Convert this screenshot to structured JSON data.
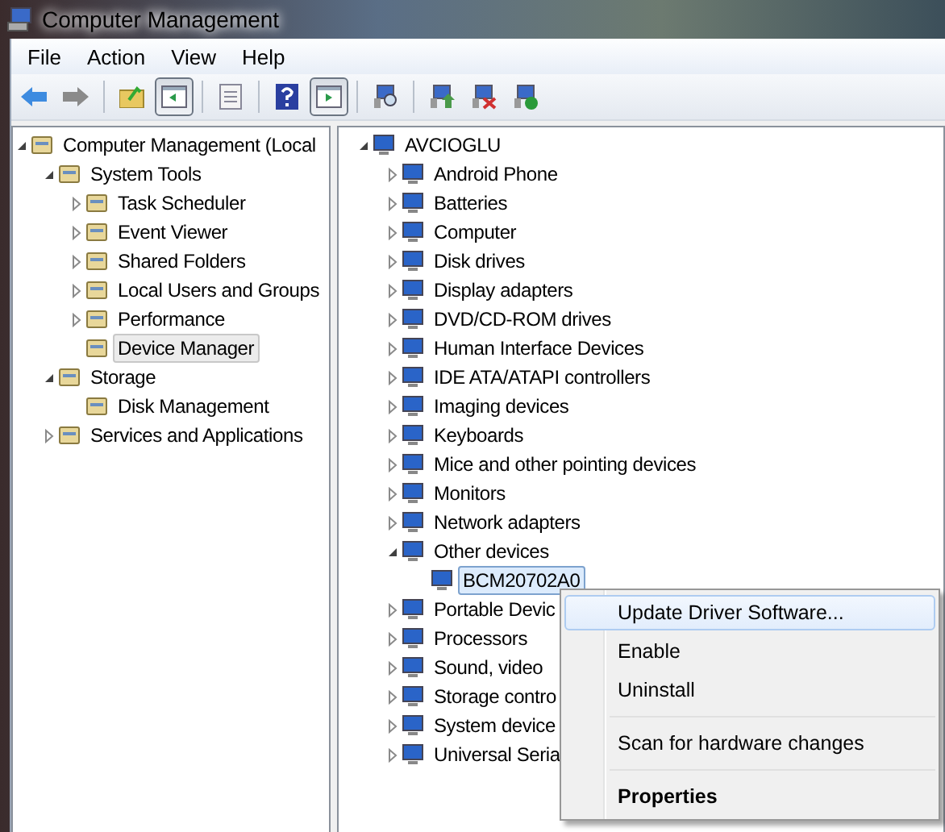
{
  "window": {
    "title": "Computer Management"
  },
  "menu": [
    "File",
    "Action",
    "View",
    "Help"
  ],
  "toolbar": [
    {
      "kind": "back",
      "pressed": false
    },
    {
      "kind": "forward",
      "pressed": false
    },
    {
      "kind": "separator"
    },
    {
      "kind": "up",
      "pressed": false
    },
    {
      "kind": "tree",
      "pressed": true
    },
    {
      "kind": "separator"
    },
    {
      "kind": "props",
      "pressed": false
    },
    {
      "kind": "separator"
    },
    {
      "kind": "help",
      "pressed": false
    },
    {
      "kind": "pane",
      "pressed": true
    },
    {
      "kind": "separator"
    },
    {
      "kind": "scan",
      "pressed": false
    },
    {
      "kind": "separator"
    },
    {
      "kind": "update",
      "pressed": false
    },
    {
      "kind": "disable",
      "pressed": false
    },
    {
      "kind": "enable",
      "pressed": false
    }
  ],
  "console_tree": [
    {
      "label": "Computer Management (Local",
      "selected": false,
      "expanded": true,
      "children": [
        {
          "label": "System Tools",
          "selected": false,
          "expanded": true,
          "children": [
            {
              "label": "Task Scheduler",
              "selected": false,
              "expanded": false
            },
            {
              "label": "Event Viewer",
              "selected": false,
              "expanded": false
            },
            {
              "label": "Shared Folders",
              "selected": false,
              "expanded": false
            },
            {
              "label": "Local Users and Groups",
              "selected": false,
              "expanded": false
            },
            {
              "label": "Performance",
              "selected": false,
              "expanded": false
            },
            {
              "label": "Device Manager",
              "selected": true
            }
          ]
        },
        {
          "label": "Storage",
          "selected": false,
          "expanded": true,
          "children": [
            {
              "label": "Disk Management",
              "selected": false
            }
          ]
        },
        {
          "label": "Services and Applications",
          "selected": false,
          "expanded": false
        }
      ]
    }
  ],
  "device_tree": [
    {
      "label": "AVCIOGLU",
      "selected": false,
      "expanded": true,
      "children": [
        {
          "label": "Android Phone",
          "selected": false,
          "expanded": false
        },
        {
          "label": "Batteries",
          "selected": false,
          "expanded": false
        },
        {
          "label": "Computer",
          "selected": false,
          "expanded": false
        },
        {
          "label": "Disk drives",
          "selected": false,
          "expanded": false
        },
        {
          "label": "Display adapters",
          "selected": false,
          "expanded": false
        },
        {
          "label": "DVD/CD-ROM drives",
          "selected": false,
          "expanded": false
        },
        {
          "label": "Human Interface Devices",
          "selected": false,
          "expanded": false
        },
        {
          "label": "IDE ATA/ATAPI controllers",
          "selected": false,
          "expanded": false
        },
        {
          "label": "Imaging devices",
          "selected": false,
          "expanded": false
        },
        {
          "label": "Keyboards",
          "selected": false,
          "expanded": false
        },
        {
          "label": "Mice and other pointing devices",
          "selected": false,
          "expanded": false
        },
        {
          "label": "Monitors",
          "selected": false,
          "expanded": false
        },
        {
          "label": "Network adapters",
          "selected": false,
          "expanded": false
        },
        {
          "label": "Other devices",
          "selected": false,
          "expanded": true,
          "children": [
            {
              "label": "BCM20702A0",
              "selected": true
            }
          ]
        },
        {
          "label": "Portable Devic",
          "selected": false,
          "expanded": false
        },
        {
          "label": "Processors",
          "selected": false,
          "expanded": false
        },
        {
          "label": "Sound, video",
          "selected": false,
          "expanded": false
        },
        {
          "label": "Storage contro",
          "selected": false,
          "expanded": false
        },
        {
          "label": "System device",
          "selected": false,
          "expanded": false
        },
        {
          "label": "Universal Seria",
          "selected": false,
          "expanded": false
        }
      ]
    }
  ],
  "context_menu": [
    {
      "kind": "item",
      "label": "Update Driver Software...",
      "highlighted": true,
      "bold": false
    },
    {
      "kind": "item",
      "label": "Enable",
      "highlighted": false,
      "bold": false
    },
    {
      "kind": "item",
      "label": "Uninstall",
      "highlighted": false,
      "bold": false
    },
    {
      "kind": "separator"
    },
    {
      "kind": "item",
      "label": "Scan for hardware changes",
      "highlighted": false,
      "bold": false
    },
    {
      "kind": "separator"
    },
    {
      "kind": "item",
      "label": "Properties",
      "highlighted": false,
      "bold": true
    }
  ]
}
